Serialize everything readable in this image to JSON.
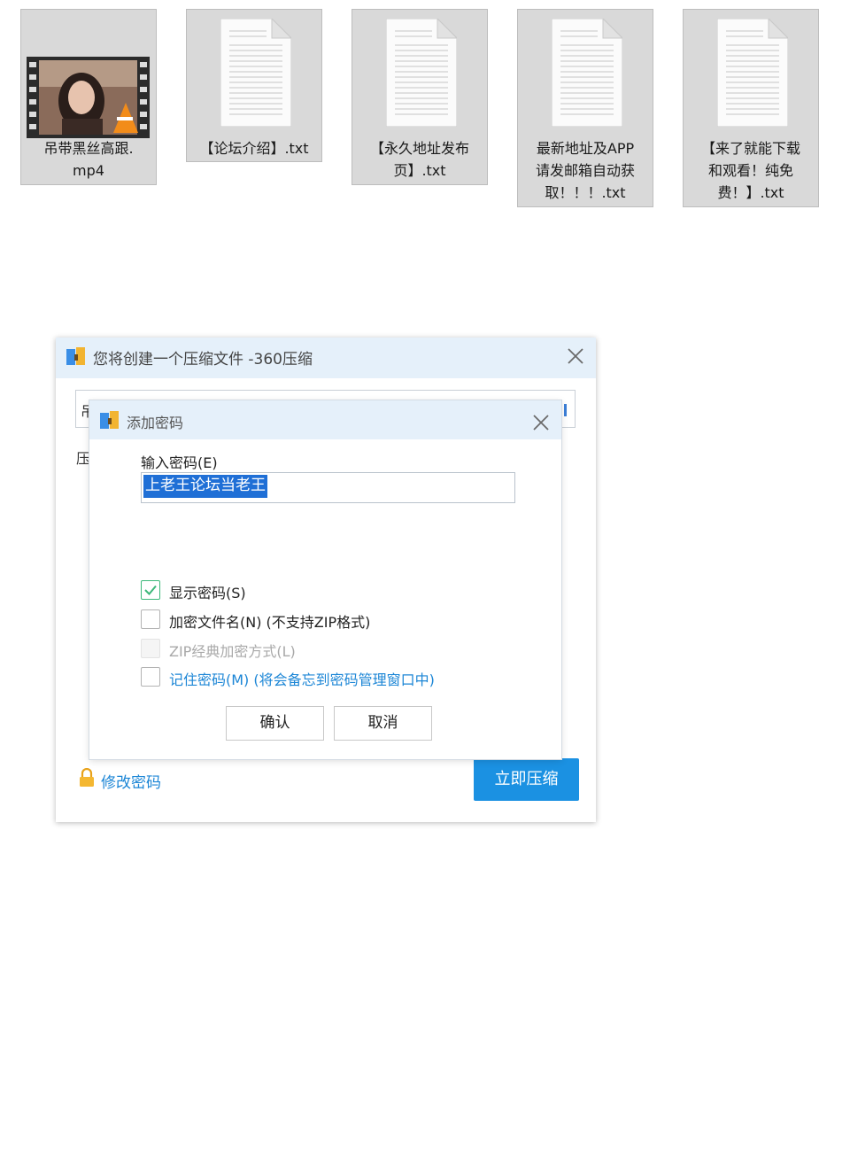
{
  "files": [
    {
      "name": "吊带黑丝高跟.\nmp4",
      "kind": "video"
    },
    {
      "name": "【论坛介绍】.txt",
      "kind": "text"
    },
    {
      "name": "【永久地址发布\n页】.txt",
      "kind": "text"
    },
    {
      "name": "最新地址及APP\n请发邮箱自动获\n取！！！.txt",
      "kind": "text"
    },
    {
      "name": "【来了就能下载\n和观看！纯免\n费！】.txt",
      "kind": "text"
    }
  ],
  "main_dialog": {
    "title": "您将创建一个压缩文件 -360压缩",
    "file_field_fragment": "吊",
    "side_label": "压",
    "change_password": "修改密码",
    "compress_button": "立即压缩"
  },
  "password_dialog": {
    "title": "添加密码",
    "input_label": "输入密码(E)",
    "password_value": "上老王论坛当老王",
    "options": [
      {
        "label": "显示密码(S)",
        "checked": true,
        "disabled": false,
        "style": "normal"
      },
      {
        "label": "加密文件名(N) (不支持ZIP格式)",
        "checked": false,
        "disabled": false,
        "style": "normal"
      },
      {
        "label": "ZIP经典加密方式(L)",
        "checked": false,
        "disabled": true,
        "style": "gray"
      },
      {
        "label": "记住密码(M) (将会备忘到密码管理窗口中)",
        "checked": false,
        "disabled": false,
        "style": "blue"
      }
    ],
    "confirm_button": "确认",
    "cancel_button": "取消"
  },
  "colors": {
    "accent": "#1b91e2",
    "titlebar": "#e5f0fa",
    "link": "#1c86d6",
    "check": "#3cb87a"
  },
  "icons": [
    "video-thumbnail-icon",
    "text-file-icon",
    "archive-app-icon",
    "close-icon",
    "lock-icon",
    "checkmark-icon"
  ]
}
